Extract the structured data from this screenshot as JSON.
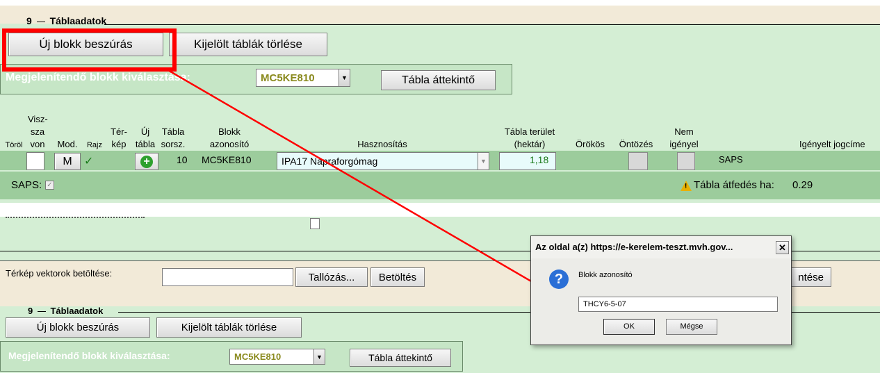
{
  "top_section": {
    "section_number": "9",
    "section_title": "Táblaadatok",
    "new_block_button": "Új blokk beszúrás",
    "delete_selected_button": "Kijelölt táblák törlése",
    "block_select_label": "Megjelenítendő blokk kiválasztása:",
    "block_select_value": "MC5KE810",
    "overview_button": "Tábla áttekintő"
  },
  "table_headers": {
    "torol": "Töröl",
    "vissza": [
      "Visz-",
      "sza",
      "von"
    ],
    "mod": "Mod.",
    "rajz": "Rajz",
    "terkep": [
      "Tér-",
      "kép"
    ],
    "uj_tabla": [
      "Új",
      "tábla"
    ],
    "tabla_sorsz": [
      "Tábla",
      "sorsz."
    ],
    "blokk_azonosito": [
      "Blokk",
      "azonosító"
    ],
    "hasznositas": "Hasznosítás",
    "tabla_terulet": [
      "Tábla terület",
      "(hektár)"
    ],
    "orokos": "Örökös",
    "ontozes": "Öntözés",
    "nem_igenyel": [
      "Nem",
      "igényel"
    ],
    "igenyelt_jogcime": "Igényelt jogcíme"
  },
  "table_row": {
    "mod_button": "M",
    "rajz_check": "✓",
    "tabla_sorsz": "10",
    "blokk_azonosito": "MC5KE810",
    "hasznositas": "IPA17 Napraforgómag",
    "terulet": "1,18",
    "jogcim": "SAPS"
  },
  "saps_row": {
    "label": "SAPS:",
    "overlap_label": "Tábla átfedés ha:",
    "overlap_value": "0.29"
  },
  "lower_section": {
    "map_vectors_label": "Térkép vektorok betöltése:",
    "browse_button": "Tallózás...",
    "load_button": "Betöltés",
    "partial_button": "ntése",
    "section_number": "9",
    "section_title": "Táblaadatok",
    "new_block_button": "Új blokk beszúrás",
    "delete_selected_button": "Kijelölt táblák törlése",
    "block_select_label": "Megjelenítendő blokk kiválasztása:",
    "block_select_value": "MC5KE810",
    "overview_button": "Tábla áttekintő"
  },
  "dialog": {
    "title": "Az oldal a(z) https://e-kerelem-teszt.mvh.gov...",
    "close": "✕",
    "prompt": "Blokk azonosító",
    "input_value": "THCY6-5-07",
    "ok_button": "OK",
    "cancel_button": "Mégse"
  },
  "colors": {
    "highlight_red": "#ff0000",
    "panel_green": "#d4eed4",
    "row_green": "#9ccc9c",
    "select_text": "#8a8a1e"
  }
}
